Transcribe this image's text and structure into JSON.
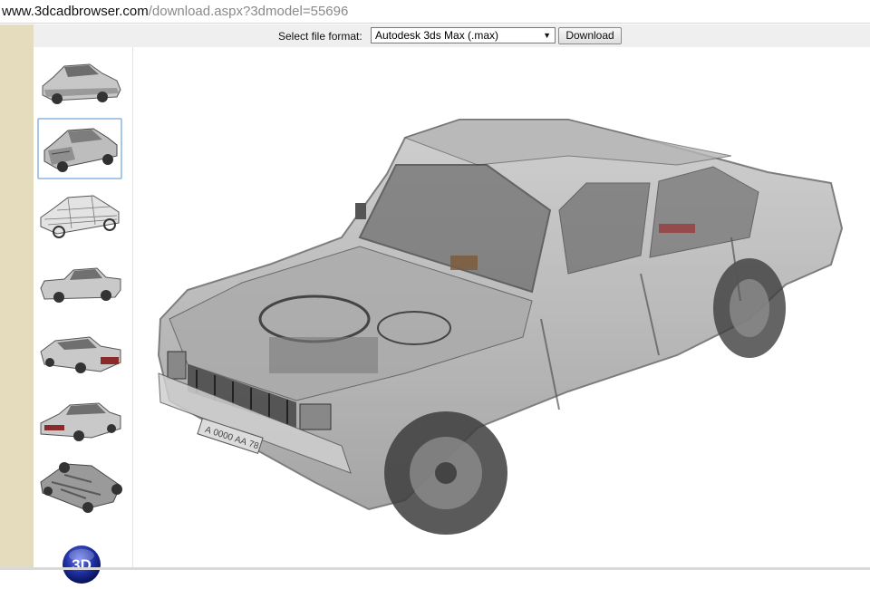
{
  "browser": {
    "url_domain": "www.3dcadbrowser.com",
    "url_path": "/download.aspx?3dmodel=55696"
  },
  "toolbar": {
    "format_label": "Select file format:",
    "format_selected": "Autodesk 3ds Max (.max)",
    "download_label": "Download"
  },
  "thumbnails": {
    "count": 7,
    "selected_index": 1,
    "items": [
      "car-front-angle-view",
      "car-xray-front-view",
      "car-wireframe-view",
      "car-side-view",
      "car-rear-angle-view",
      "car-rear-view",
      "car-underside-view"
    ]
  },
  "viewer": {
    "icon": "3d-button-icon",
    "model_icon": "car-xray-render",
    "plate_text": "А 0000 АА 78"
  },
  "colors": {
    "left_strip": "#e5dcbd",
    "toolbar_bg": "#efefef",
    "selected_border": "#a8c7e8",
    "button_3d": "#1d2fa0"
  }
}
